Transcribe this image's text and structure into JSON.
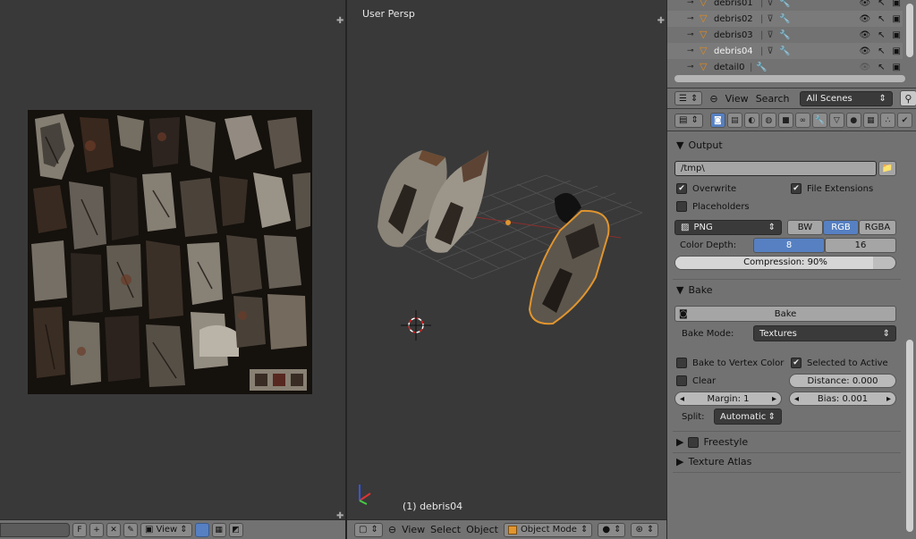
{
  "image_editor": {
    "footer": {
      "name_value": "",
      "fake_user_label": "F",
      "view_menu": "View"
    }
  },
  "viewport": {
    "label": "User Persp",
    "active_object": "(1) debris04",
    "footer": {
      "view": "View",
      "select": "Select",
      "object": "Object",
      "mode": "Object Mode"
    }
  },
  "outliner": {
    "rows": [
      {
        "name": "debris01"
      },
      {
        "name": "debris02"
      },
      {
        "name": "debris03"
      },
      {
        "name": "debris04"
      },
      {
        "name": "detail0"
      }
    ],
    "header": {
      "view": "View",
      "search": "Search",
      "scene_filter": "All Scenes"
    }
  },
  "properties": {
    "output": {
      "title": "Output",
      "path": "/tmp\\",
      "overwrite": "Overwrite",
      "file_extensions": "File Extensions",
      "placeholders": "Placeholders",
      "format": "PNG",
      "color_modes": [
        "BW",
        "RGB",
        "RGBA"
      ],
      "active_color_mode": "RGB",
      "color_depth_label": "Color Depth:",
      "depths": [
        "8",
        "16"
      ],
      "compression": "Compression: 90%",
      "compression_fraction": 0.9
    },
    "bake": {
      "title": "Bake",
      "bake_button": "Bake",
      "mode_label": "Bake Mode:",
      "mode_value": "Textures",
      "to_vertex_color": "Bake to Vertex Color",
      "selected_to_active": "Selected to Active",
      "clear": "Clear",
      "distance": "Distance: 0.000",
      "margin": "Margin: 1",
      "bias": "Bias: 0.001",
      "split_label": "Split:",
      "split_value": "Automatic"
    },
    "freestyle": {
      "title": "Freestyle"
    },
    "texture_atlas": {
      "title": "Texture Atlas"
    }
  },
  "colors": {
    "accent_blue": "#5680c2",
    "selection_orange": "#e0952e",
    "panel_grey": "#727272",
    "viewport_bg": "#393939"
  }
}
